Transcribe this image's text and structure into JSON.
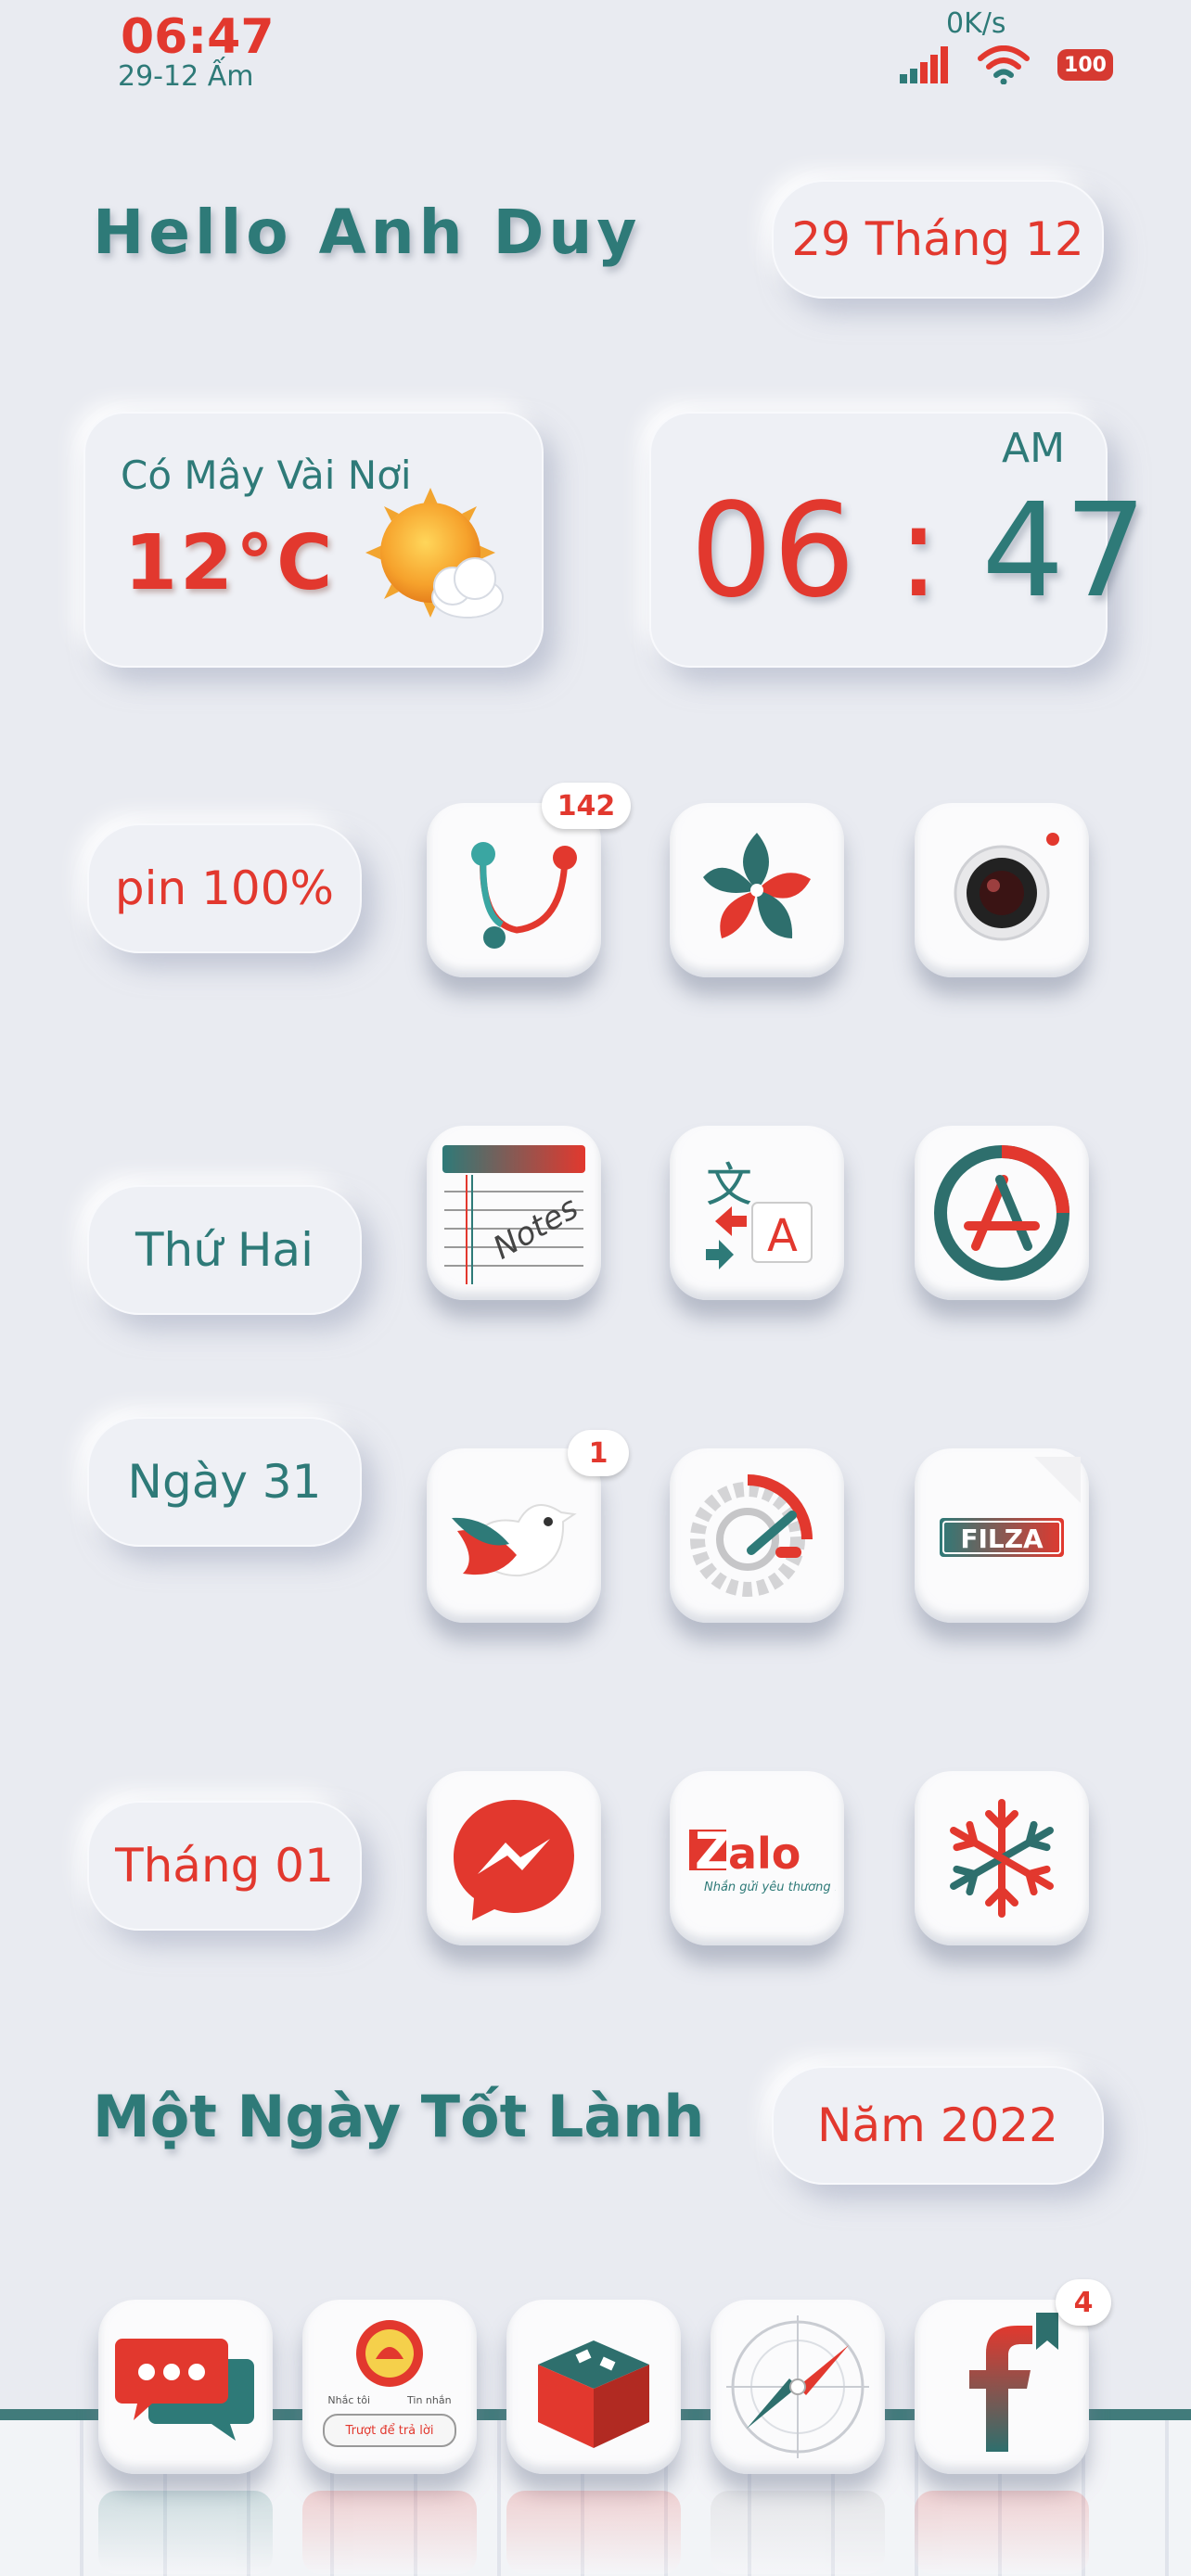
{
  "status_bar": {
    "time": "06:47",
    "date": "29-12 Ấm",
    "network_speed": "0K/s",
    "battery_level": "100",
    "icons": [
      "cellular-signal-icon",
      "wifi-icon",
      "battery-icon"
    ]
  },
  "header": {
    "greeting": "Hello Anh Duy",
    "date_pill": "29 Tháng 12"
  },
  "weather": {
    "condition": "Có Mây Vài Nơi",
    "temperature": "12°C",
    "icon": "sun-cloud-icon"
  },
  "clock": {
    "ampm": "AM",
    "hour": "06",
    "separator": ":",
    "minute": "47"
  },
  "side_pills": {
    "battery": "pin 100%",
    "weekday": "Thứ Hai",
    "day": "Ngày 31",
    "month": "Tháng 01"
  },
  "apps": {
    "row1": [
      {
        "icon": "stethoscope-app-icon",
        "badge": "142"
      },
      {
        "icon": "pinwheel-photos-icon"
      },
      {
        "icon": "camera-icon"
      }
    ],
    "row2": [
      {
        "icon": "notes-icon",
        "label": "Notes"
      },
      {
        "icon": "translate-icon"
      },
      {
        "icon": "app-store-icon"
      }
    ],
    "row3": [
      {
        "icon": "bird-app-icon",
        "badge": "1"
      },
      {
        "icon": "settings-gear-icon"
      },
      {
        "icon": "filza-icon",
        "label": "FILZA"
      }
    ],
    "row4": [
      {
        "icon": "messenger-icon"
      },
      {
        "icon": "zalo-icon",
        "label": "Zalo",
        "tagline": "Nhắn gửi yêu thương !"
      },
      {
        "icon": "snowflake-icon"
      }
    ]
  },
  "footer": {
    "motto": "Một Ngày Tốt Lành",
    "year_pill": "Năm 2022"
  },
  "dock": [
    {
      "icon": "messages-icon"
    },
    {
      "icon": "phone-call-icon",
      "lines": [
        "Nhắc tôi",
        "Tin nhắn",
        "Trượt để trả lời"
      ]
    },
    {
      "icon": "cydia-box-icon"
    },
    {
      "icon": "safari-compass-icon"
    },
    {
      "icon": "facebook-icon",
      "badge": "4"
    }
  ],
  "colors": {
    "accent_red": "#e2382e",
    "accent_teal": "#2e7a78",
    "background": "#e9ebf1"
  }
}
